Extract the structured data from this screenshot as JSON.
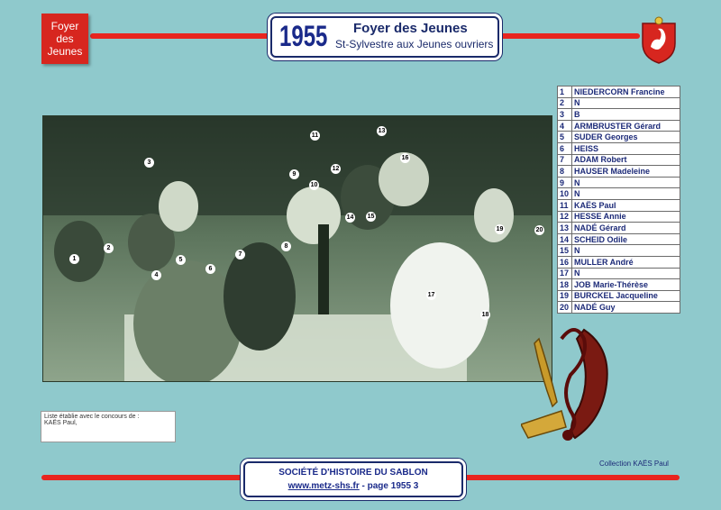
{
  "badge": {
    "label_line1": "Foyer",
    "label_line2": "des",
    "label_line3": "Jeunes"
  },
  "header": {
    "year": "1955",
    "title": "Foyer des Jeunes",
    "subtitle": "St-Sylvestre aux Jeunes ouvriers"
  },
  "photo": {
    "markers": [
      "1",
      "2",
      "3",
      "4",
      "5",
      "6",
      "7",
      "8",
      "9",
      "10",
      "11",
      "12",
      "13",
      "14",
      "15",
      "16",
      "17",
      "18",
      "19",
      "20"
    ]
  },
  "people": [
    {
      "num": "1",
      "name": "NIEDERCORN Francine"
    },
    {
      "num": "2",
      "name": "N"
    },
    {
      "num": "3",
      "name": "B"
    },
    {
      "num": "4",
      "name": "ARMBRUSTER Gérard"
    },
    {
      "num": "5",
      "name": "SUDER Georges"
    },
    {
      "num": "6",
      "name": "HEISS"
    },
    {
      "num": "7",
      "name": "ADAM Robert"
    },
    {
      "num": "8",
      "name": "HAUSER Madeleine"
    },
    {
      "num": "9",
      "name": "N"
    },
    {
      "num": "10",
      "name": "N"
    },
    {
      "num": "11",
      "name": "KAËS Paul"
    },
    {
      "num": "12",
      "name": "HESSE Annie"
    },
    {
      "num": "13",
      "name": "NADÉ Gérard"
    },
    {
      "num": "14",
      "name": "SCHEID Odile"
    },
    {
      "num": "15",
      "name": "N"
    },
    {
      "num": "16",
      "name": "MULLER André"
    },
    {
      "num": "17",
      "name": "N"
    },
    {
      "num": "18",
      "name": "JOB Marie-Thérèse"
    },
    {
      "num": "19",
      "name": "BURCKEL Jacqueline"
    },
    {
      "num": "20",
      "name": "NADÉ Guy"
    }
  ],
  "credit": {
    "line1": "Liste établie avec le concours de :",
    "line2": "KAËS Paul,"
  },
  "collection": "Collection KAËS Paul",
  "footer": {
    "society": "SOCIÉTÉ D'HISTOIRE DU SABLON",
    "link": "www.metz-shs.fr",
    "page": " - page 1955 3"
  },
  "colors": {
    "background": "#8fc9cc",
    "accent_red": "#e8251f",
    "navy": "#1a2a6a"
  }
}
